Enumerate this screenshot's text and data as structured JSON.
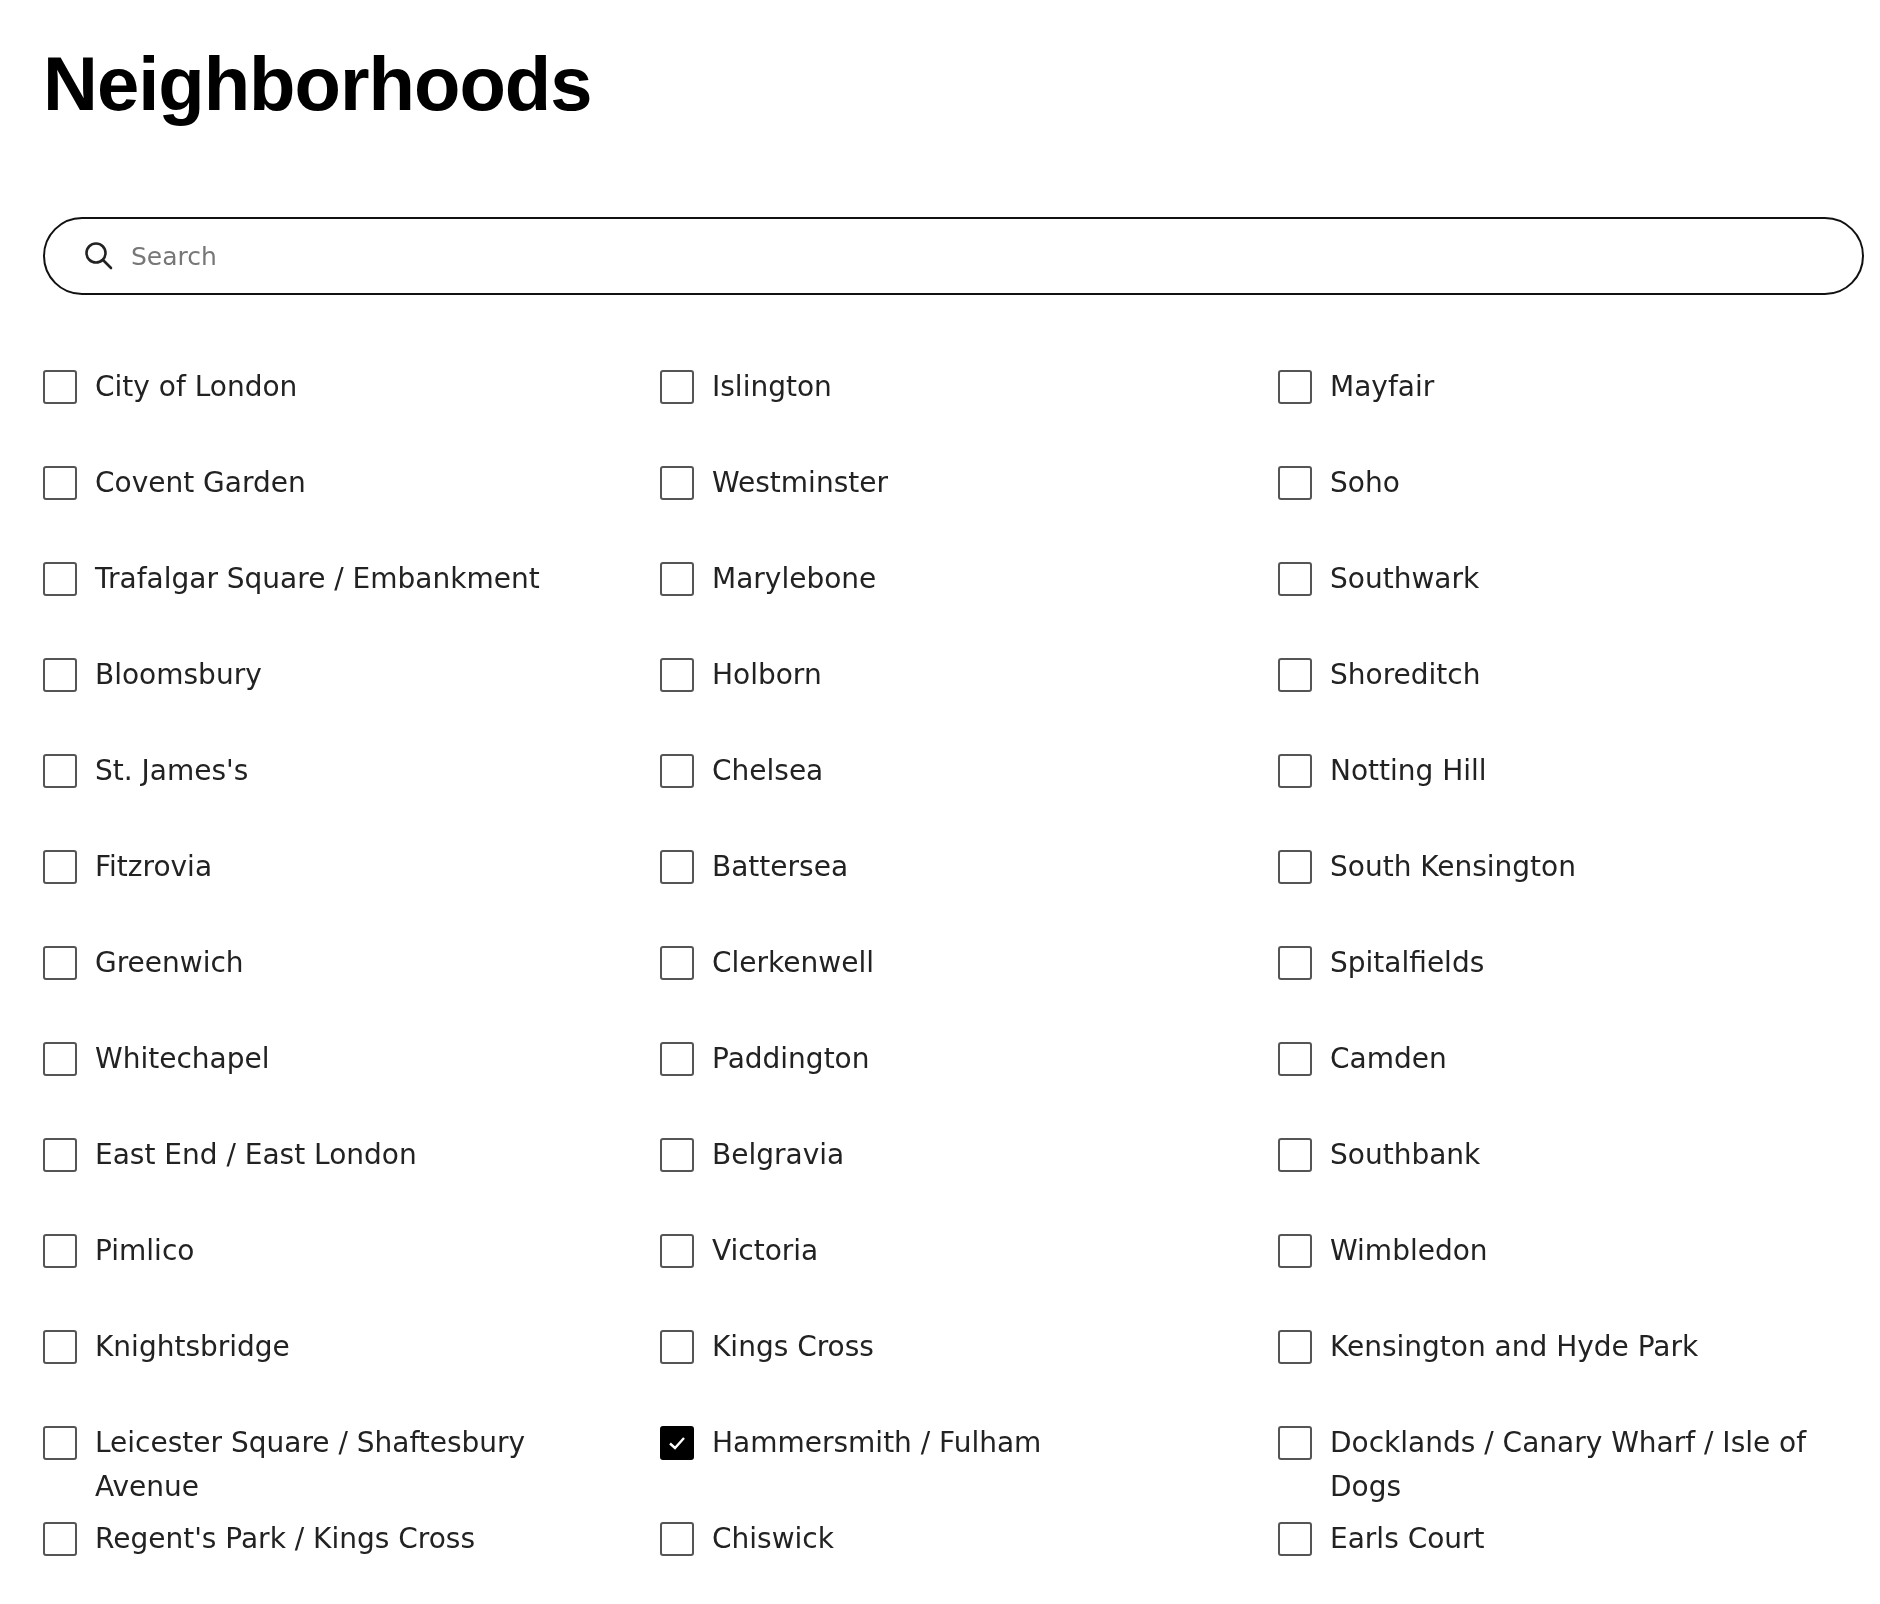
{
  "title": "Neighborhoods",
  "search": {
    "placeholder": "Search"
  },
  "neighborhoods": [
    {
      "label": "City of London",
      "checked": false
    },
    {
      "label": "Islington",
      "checked": false
    },
    {
      "label": "Mayfair",
      "checked": false
    },
    {
      "label": "Covent Garden",
      "checked": false
    },
    {
      "label": "Westminster",
      "checked": false
    },
    {
      "label": "Soho",
      "checked": false
    },
    {
      "label": "Trafalgar Square / Embankment",
      "checked": false
    },
    {
      "label": "Marylebone",
      "checked": false
    },
    {
      "label": "Southwark",
      "checked": false
    },
    {
      "label": "Bloomsbury",
      "checked": false
    },
    {
      "label": "Holborn",
      "checked": false
    },
    {
      "label": "Shoreditch",
      "checked": false
    },
    {
      "label": "St. James's",
      "checked": false
    },
    {
      "label": "Chelsea",
      "checked": false
    },
    {
      "label": "Notting Hill",
      "checked": false
    },
    {
      "label": "Fitzrovia",
      "checked": false
    },
    {
      "label": "Battersea",
      "checked": false
    },
    {
      "label": "South Kensington",
      "checked": false
    },
    {
      "label": "Greenwich",
      "checked": false
    },
    {
      "label": "Clerkenwell",
      "checked": false
    },
    {
      "label": "Spitalfields",
      "checked": false
    },
    {
      "label": "Whitechapel",
      "checked": false
    },
    {
      "label": "Paddington",
      "checked": false
    },
    {
      "label": "Camden",
      "checked": false
    },
    {
      "label": "East End / East London",
      "checked": false
    },
    {
      "label": "Belgravia",
      "checked": false
    },
    {
      "label": "Southbank",
      "checked": false
    },
    {
      "label": "Pimlico",
      "checked": false
    },
    {
      "label": "Victoria",
      "checked": false
    },
    {
      "label": "Wimbledon",
      "checked": false
    },
    {
      "label": "Knightsbridge",
      "checked": false
    },
    {
      "label": "Kings Cross",
      "checked": false
    },
    {
      "label": "Kensington and Hyde Park",
      "checked": false
    },
    {
      "label": "Leicester Square / Shaftesbury Avenue",
      "checked": false
    },
    {
      "label": "Hammersmith / Fulham",
      "checked": true
    },
    {
      "label": "Docklands / Canary Wharf / Isle of Dogs",
      "checked": false
    },
    {
      "label": "Regent's Park / Kings Cross",
      "checked": false
    },
    {
      "label": "Chiswick",
      "checked": false
    },
    {
      "label": "Earls Court",
      "checked": false
    }
  ]
}
